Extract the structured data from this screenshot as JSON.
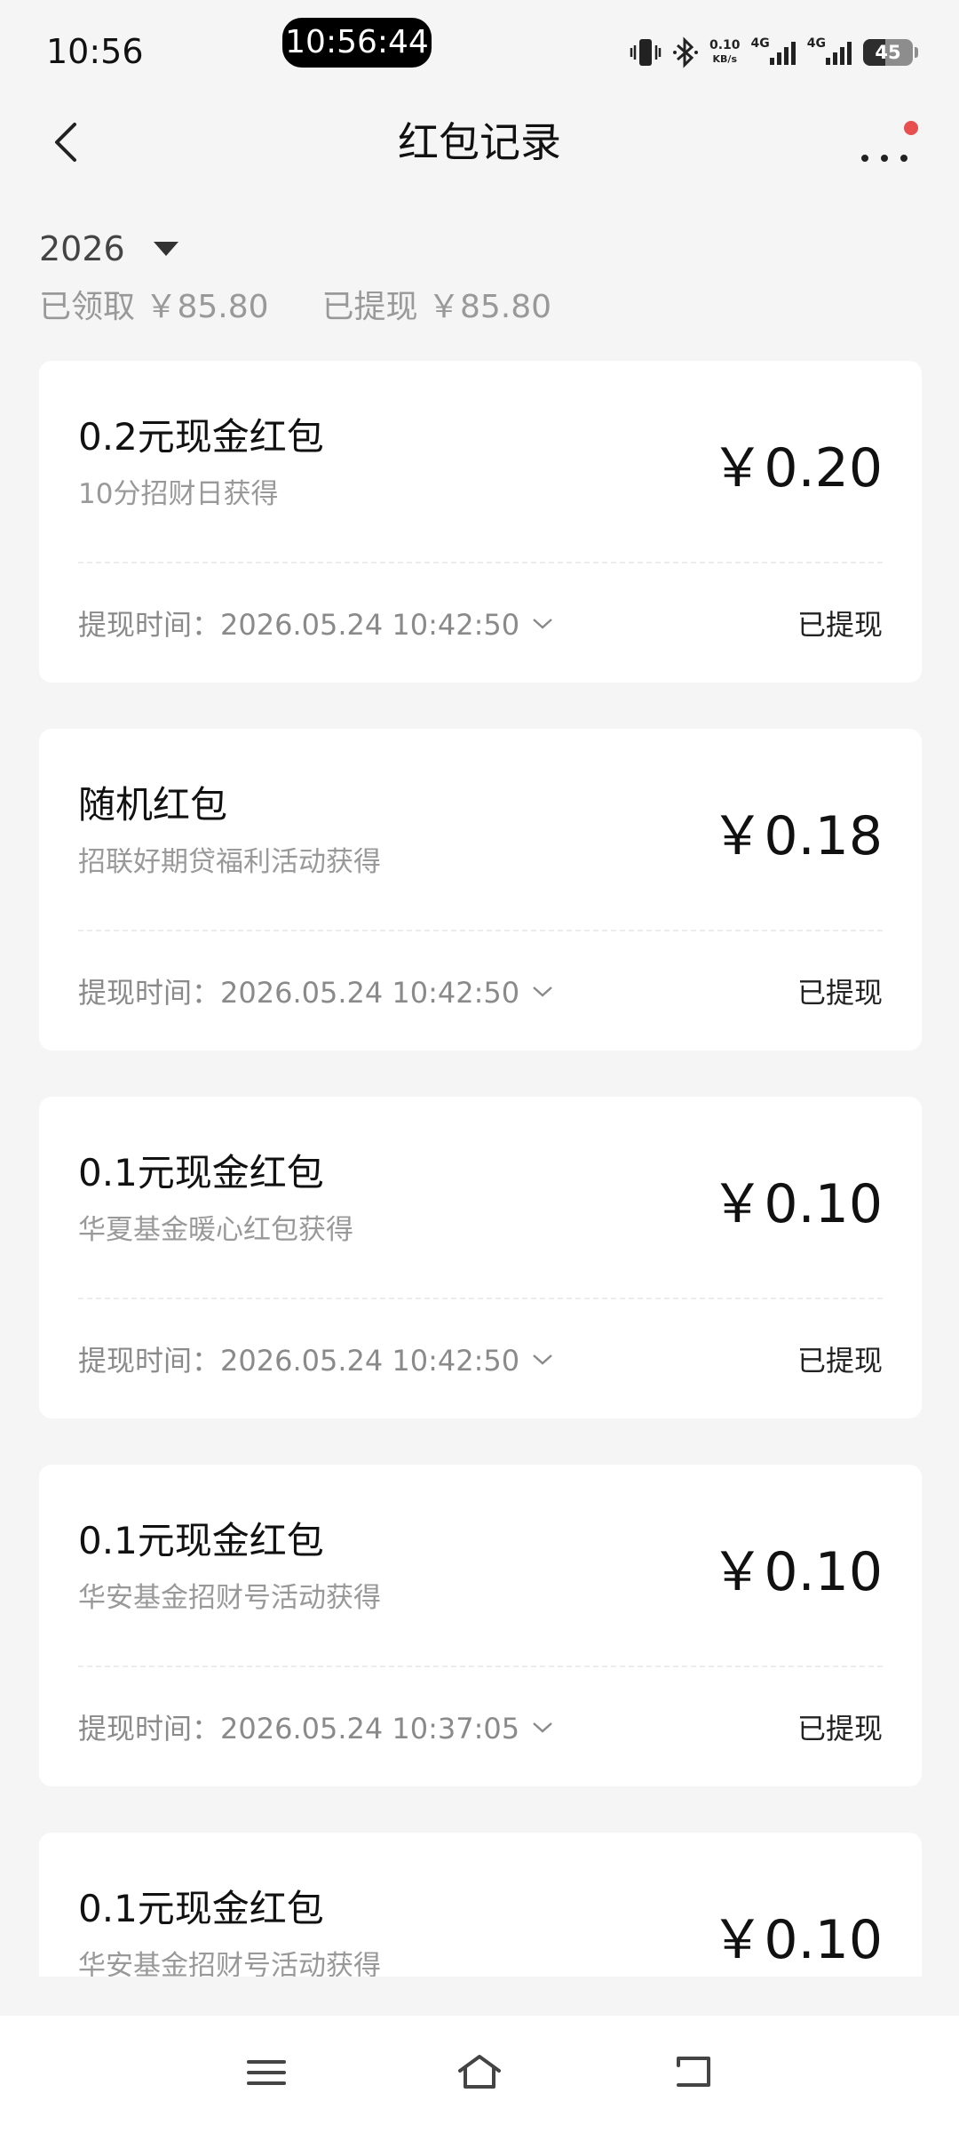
{
  "status_bar": {
    "time": "10:56",
    "center_pill_time": "10:56:44",
    "net_speed_value": "0.10",
    "net_speed_unit": "KB/s",
    "network_1": "4G",
    "network_2": "4G",
    "battery_level": "45",
    "battery_fraction": 0.45
  },
  "header": {
    "title": "红包记录"
  },
  "summary": {
    "year": "2026",
    "received": "已领取 ￥85.80",
    "withdrawn": "已提现 ￥85.80"
  },
  "records": [
    {
      "title": "0.2元现金红包",
      "source": "10分招财日获得",
      "amount": "￥0.20",
      "time": "提现时间：2026.05.24 10:42:50",
      "status": "已提现"
    },
    {
      "title": "随机红包",
      "source": "招联好期贷福利活动获得",
      "amount": "￥0.18",
      "time": "提现时间：2026.05.24 10:42:50",
      "status": "已提现"
    },
    {
      "title": "0.1元现金红包",
      "source": "华夏基金暖心红包获得",
      "amount": "￥0.10",
      "time": "提现时间：2026.05.24 10:42:50",
      "status": "已提现"
    },
    {
      "title": "0.1元现金红包",
      "source": "华安基金招财号活动获得",
      "amount": "￥0.10",
      "time": "提现时间：2026.05.24 10:37:05",
      "status": "已提现"
    },
    {
      "title": "0.1元现金红包",
      "source": "华安基金招财号活动获得",
      "amount": "￥0.10",
      "time": "",
      "status": ""
    }
  ],
  "colors": {
    "background": "#f5f5f5",
    "card": "#ffffff",
    "text_primary": "#111111",
    "text_secondary": "#999999",
    "notification_dot": "#e84f4f"
  },
  "icons": {
    "back": "chevron-left-icon",
    "more": "more-dots-icon",
    "year_dropdown": "triangle-down-icon",
    "expand": "chevron-down-icon",
    "nav_menu": "menu-icon",
    "nav_home": "home-icon",
    "nav_back": "back-icon"
  }
}
